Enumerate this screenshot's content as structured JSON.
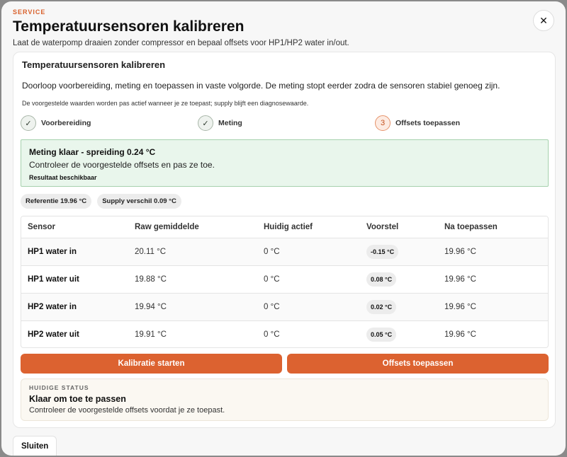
{
  "header": {
    "eyebrow": "SERVICE",
    "title": "Temperatuursensoren kalibreren",
    "subtitle": "Laat de waterpomp draaien zonder compressor en bepaal offsets voor HP1/HP2 water in/out.",
    "close_icon": "close-icon",
    "close_glyph": "✕"
  },
  "card": {
    "title": "Temperatuursensoren kalibreren",
    "description": "Doorloop voorbereiding, meting en toepassen in vaste volgorde. De meting stopt eerder zodra de sensoren stabiel genoeg zijn.",
    "note": "De voorgestelde waarden worden pas actief wanneer je ze toepast; supply blijft een diagnosewaarde."
  },
  "steps": [
    {
      "indicator": "✓",
      "label": "Voorbereiding",
      "state": "done"
    },
    {
      "indicator": "✓",
      "label": "Meting",
      "state": "done"
    },
    {
      "indicator": "3",
      "label": "Offsets toepassen",
      "state": "active"
    }
  ],
  "result": {
    "title": "Meting klaar - spreiding 0.24 °C",
    "text": "Controleer de voorgestelde offsets en pas ze toe.",
    "badge": "Resultaat beschikbaar"
  },
  "chips": {
    "reference": "Referentie 19.96 °C",
    "supply": "Supply verschil 0.09 °C"
  },
  "table": {
    "headers": [
      "Sensor",
      "Raw gemiddelde",
      "Huidig actief",
      "Voorstel",
      "Na toepassen"
    ],
    "rows": [
      {
        "sensor": "HP1 water in",
        "raw": "20.11 °C",
        "current": "0 °C",
        "proposal": "-0.15 °C",
        "after": "19.96 °C"
      },
      {
        "sensor": "HP1 water uit",
        "raw": "19.88 °C",
        "current": "0 °C",
        "proposal": "0.08 °C",
        "after": "19.96 °C"
      },
      {
        "sensor": "HP2 water in",
        "raw": "19.94 °C",
        "current": "0 °C",
        "proposal": "0.02 °C",
        "after": "19.96 °C"
      },
      {
        "sensor": "HP2 water uit",
        "raw": "19.91 °C",
        "current": "0 °C",
        "proposal": "0.05 °C",
        "after": "19.96 °C"
      }
    ]
  },
  "buttons": {
    "start": "Kalibratie starten",
    "apply": "Offsets toepassen"
  },
  "status": {
    "eyebrow": "HUIDIGE STATUS",
    "title": "Klaar om toe te passen",
    "text": "Controleer de voorgestelde offsets voordat je ze toepast."
  },
  "footer": {
    "close_label": "Sluiten"
  },
  "colors": {
    "accent": "#dc6230",
    "success_bg": "#e9f6ec",
    "success_border": "#a6d1ad"
  }
}
